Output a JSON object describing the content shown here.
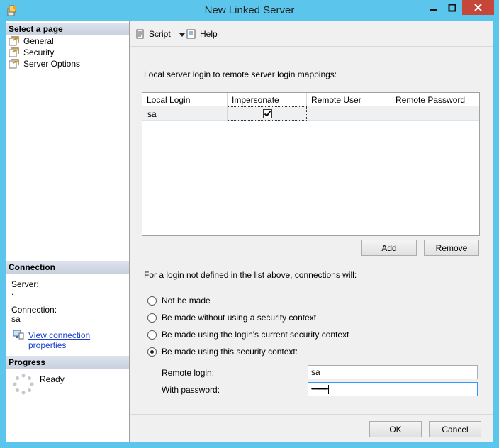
{
  "window": {
    "title": "New Linked Server"
  },
  "left": {
    "select_page_header": "Select a page",
    "pages": [
      {
        "label": "General"
      },
      {
        "label": "Security"
      },
      {
        "label": "Server Options"
      }
    ],
    "connection_header": "Connection",
    "server_label": "Server:",
    "server_value": ".",
    "connection_label": "Connection:",
    "connection_value": "sa",
    "view_props_link": "View connection properties",
    "progress_header": "Progress",
    "progress_status": "Ready"
  },
  "toolbar": {
    "script_label": "Script",
    "help_label": "Help"
  },
  "mappings": {
    "caption": "Local server login to remote server login mappings:",
    "columns": [
      "Local Login",
      "Impersonate",
      "Remote User",
      "Remote Password"
    ],
    "rows": [
      {
        "local_login": "sa",
        "impersonate": true,
        "remote_user": "",
        "remote_password": ""
      }
    ],
    "add_label": "Add",
    "remove_label": "Remove"
  },
  "not_defined": {
    "caption": "For a login not defined in the list above, connections will:",
    "options": [
      {
        "label": "Not be made",
        "selected": false
      },
      {
        "label": "Be made without using a security context",
        "selected": false
      },
      {
        "label": "Be made using the login's current security context",
        "selected": false
      },
      {
        "label": "Be made using this security context:",
        "selected": true
      }
    ],
    "remote_login_label": "Remote login:",
    "remote_login_value": "sa",
    "password_label": "With password:",
    "password_value": "••••••••••••••••"
  },
  "footer": {
    "ok_label": "OK",
    "cancel_label": "Cancel"
  },
  "colors": {
    "frame": "#5cc5ec",
    "close_button": "#c7463a",
    "link": "#1a3ecc"
  }
}
